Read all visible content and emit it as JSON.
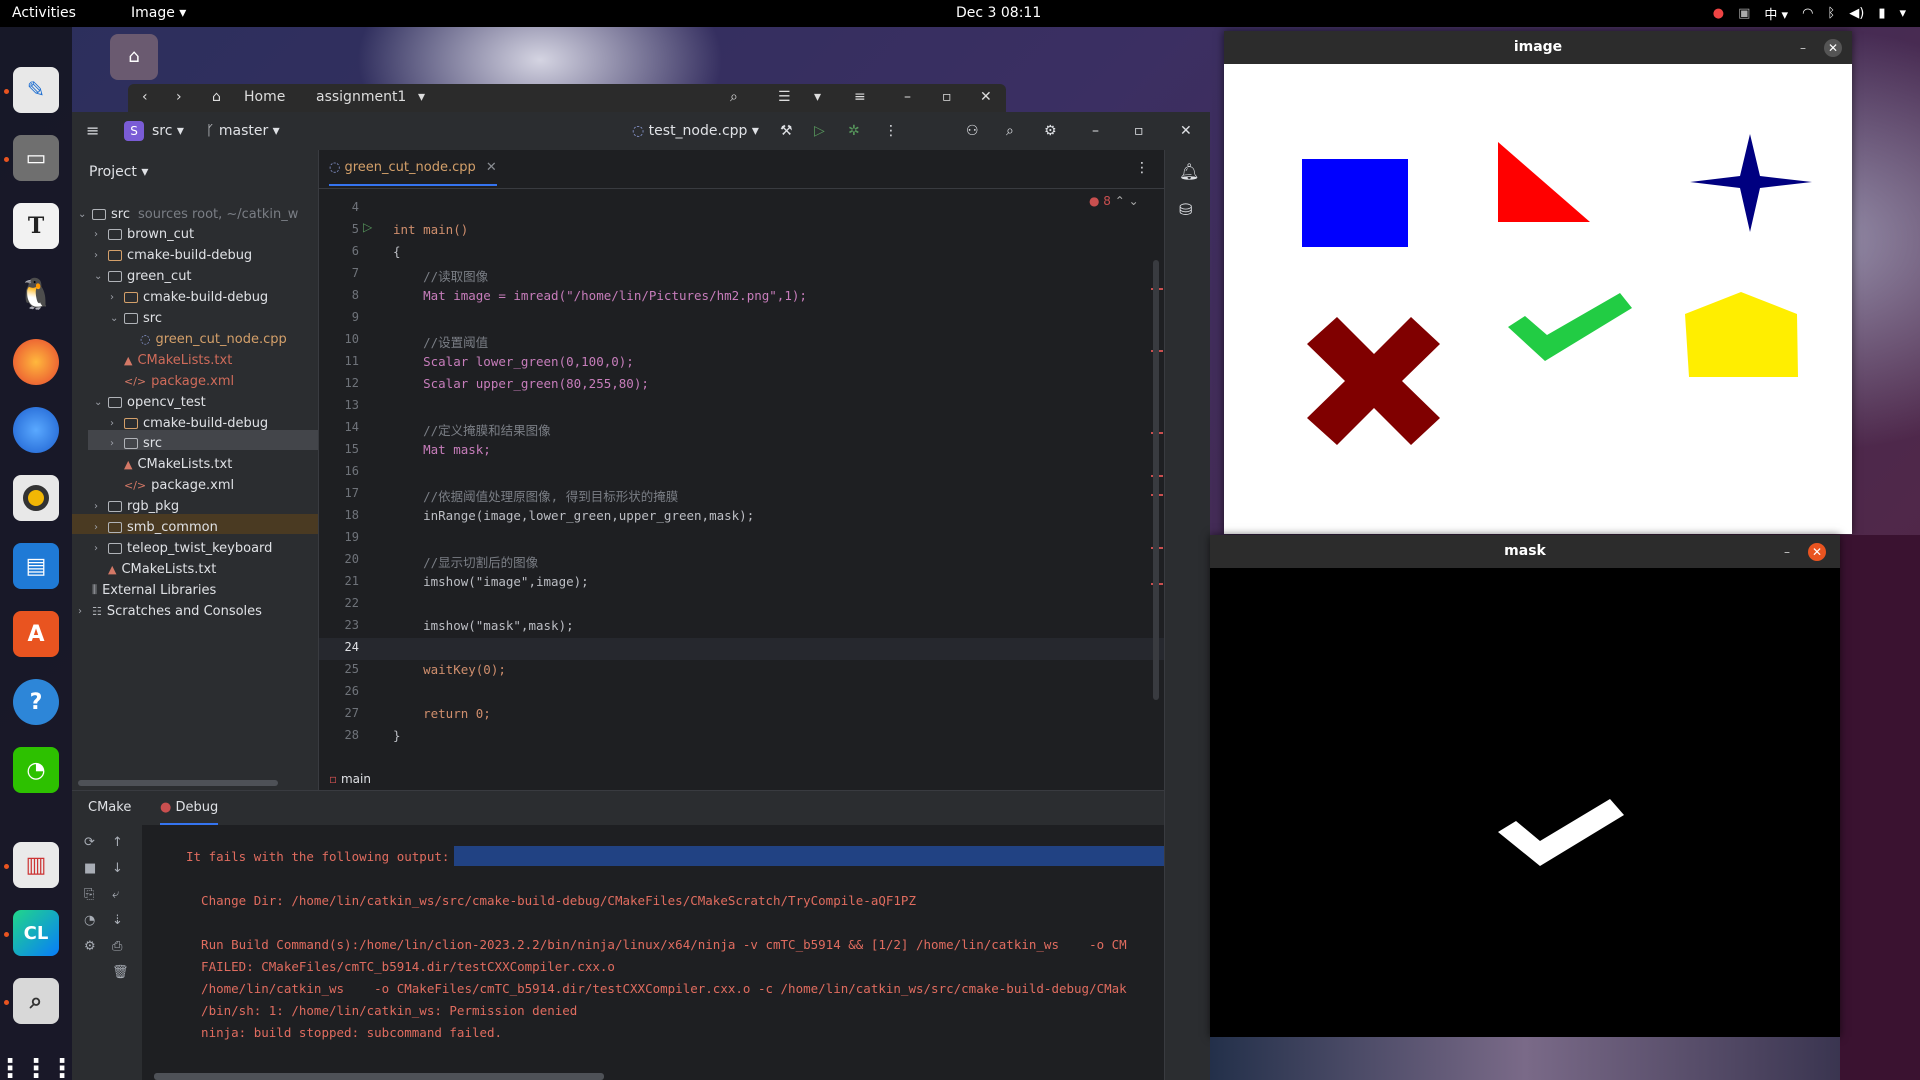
{
  "topbar": {
    "activities": "Activities",
    "app_menu": "Image",
    "clock": "Dec 3  08:11",
    "input_method": "中"
  },
  "files": {
    "home_label": "Home",
    "path_label": "assignment1"
  },
  "ide": {
    "project_badge": "S",
    "project_name": "src",
    "branch": "master",
    "run_config": "test_node.cpp",
    "project_header": "Project",
    "tree": [
      {
        "label": "src",
        "extra": "sources root, ~/catkin_w",
        "type": "folder",
        "level": 0,
        "open": true
      },
      {
        "label": "brown_cut",
        "type": "folder",
        "level": 1,
        "open": false
      },
      {
        "label": "cmake-build-debug",
        "type": "folder",
        "level": 1,
        "open": false
      },
      {
        "label": "green_cut",
        "type": "folder",
        "level": 1,
        "open": true
      },
      {
        "label": "cmake-build-debug",
        "type": "folder",
        "level": 2,
        "open": false
      },
      {
        "label": "src",
        "type": "folder",
        "level": 2,
        "open": true
      },
      {
        "label": "green_cut_node.cpp",
        "type": "cpp",
        "level": 3
      },
      {
        "label": "CMakeLists.txt",
        "type": "cmake",
        "level": 2
      },
      {
        "label": "package.xml",
        "type": "xml",
        "level": 2
      },
      {
        "label": "opencv_test",
        "type": "folder",
        "level": 1,
        "open": true
      },
      {
        "label": "cmake-build-debug",
        "type": "folder",
        "level": 2,
        "open": false
      },
      {
        "label": "src",
        "type": "folder",
        "level": 2,
        "open": false
      },
      {
        "label": "CMakeLists.txt",
        "type": "cmake",
        "level": 2
      },
      {
        "label": "package.xml",
        "type": "xml",
        "level": 2
      },
      {
        "label": "rgb_pkg",
        "type": "folder",
        "level": 1,
        "open": false
      },
      {
        "label": "smb_common",
        "type": "folder",
        "level": 1,
        "open": false
      },
      {
        "label": "teleop_twist_keyboard",
        "type": "folder",
        "level": 1,
        "open": false
      },
      {
        "label": "CMakeLists.txt",
        "type": "cmake",
        "level": 1
      },
      {
        "label": "External Libraries",
        "type": "lib",
        "level": 0
      },
      {
        "label": "Scratches and Consoles",
        "type": "scratch",
        "level": 0
      }
    ],
    "tab_label": "green_cut_node.cpp",
    "error_count": "8",
    "line_numbers": [
      "4",
      "5",
      "6",
      "7",
      "8",
      "9",
      "10",
      "11",
      "12",
      "13",
      "14",
      "15",
      "16",
      "17",
      "18",
      "19",
      "20",
      "21",
      "22",
      "23",
      "24",
      "25",
      "26",
      "27",
      "28"
    ],
    "code": [
      "",
      "int main()",
      "{",
      "    //读取图像",
      "    Mat image = imread(\"/home/lin/Pictures/hm2.png\",1);",
      "",
      "    //设置阈值",
      "    Scalar lower_green(0,100,0);",
      "    Scalar upper_green(80,255,80);",
      "",
      "    //定义掩膜和结果图像",
      "    Mat mask;",
      "",
      "    //依据阈值处理原图像, 得到目标形状的掩膜",
      "    inRange(image,lower_green,upper_green,mask);",
      "",
      "    //显示切割后的图像",
      "    imshow(\"image\",image);",
      "",
      "    imshow(\"mask\",mask);",
      "",
      "    waitKey(0);",
      "",
      "    return 0;",
      "}"
    ],
    "breadcrumb": "main",
    "bottom_tabs": {
      "cmake": "CMake",
      "debug": "Debug"
    },
    "console": [
      "It fails with the following output:",
      "",
      "  Change Dir: /home/lin/catkin_ws/src/cmake-build-debug/CMakeFiles/CMakeScratch/TryCompile-aQF1PZ",
      "",
      "  Run Build Command(s):/home/lin/clion-2023.2.2/bin/ninja/linux/x64/ninja -v cmTC_b5914 && [1/2] /home/lin/catkin_ws    -o CM",
      "  FAILED: CMakeFiles/cmTC_b5914.dir/testCXXCompiler.cxx.o",
      "  /home/lin/catkin_ws    -o CMakeFiles/cmTC_b5914.dir/testCXXCompiler.cxx.o -c /home/lin/catkin_ws/src/cmake-build-debug/CMak",
      "  /bin/sh: 1: /home/lin/catkin_ws: Permission denied",
      "  ninja: build stopped: subcommand failed."
    ]
  },
  "image_window": {
    "title": "image",
    "colors": {
      "blue": "#0000ff",
      "red": "#ff0000",
      "navy": "#000080",
      "maroon": "#800000",
      "green": "#22cc44",
      "yellow": "#ffee00"
    }
  },
  "mask_window": {
    "title": "mask"
  }
}
